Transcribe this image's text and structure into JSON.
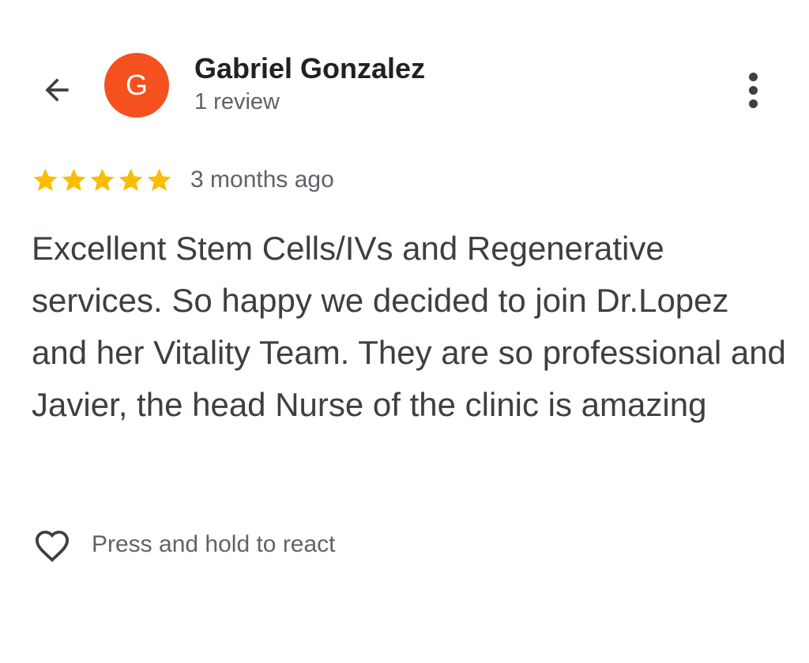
{
  "header": {
    "back_icon": "arrow-left-icon",
    "avatar_initial": "G",
    "avatar_color": "#f4511e",
    "reviewer_name": "Gabriel Gonzalez",
    "review_count": "1 review",
    "more_icon": "more-vert-icon"
  },
  "review": {
    "rating": 5,
    "rating_max": 5,
    "star_color": "#fbbc04",
    "time_ago": "3 months ago",
    "text": "Excellent Stem Cells/IVs and Regenerative services. So happy we decided to join Dr.Lopez and her Vitality Team. They are so professional and Javier, the head Nurse of the clinic is amazing"
  },
  "reaction": {
    "icon": "heart-outline-icon",
    "label": "Press and hold to react"
  }
}
